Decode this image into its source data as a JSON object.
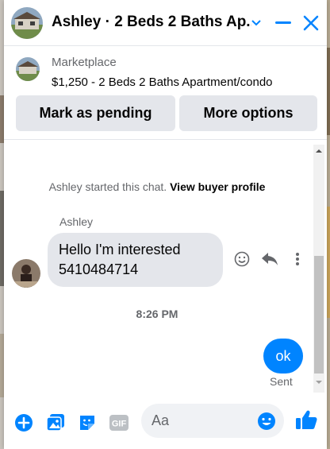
{
  "header": {
    "title": "Ashley · 2 Beds 2 Baths Ap..."
  },
  "listing": {
    "label": "Marketplace",
    "title": "$1,250 - 2 Beds 2 Baths Apartment/condo",
    "mark_pending_label": "Mark as pending",
    "more_options_label": "More options"
  },
  "conversation": {
    "started_text": "Ashley started this chat.",
    "view_profile_link": "View buyer profile",
    "sender_name": "Ashley",
    "incoming_line1": "Hello I'm interested",
    "incoming_line2": "5410484714",
    "timestamp": "8:26 PM",
    "outgoing_text": "ok",
    "status": "Sent"
  },
  "composer": {
    "placeholder": "Aa",
    "gif_label": "GIF"
  },
  "colors": {
    "accent": "#0084ff",
    "bubble_in": "#e4e6eb",
    "secondary_text": "#65676b"
  },
  "icons": [
    "chevron-down-icon",
    "minimize-icon",
    "close-icon",
    "smile-icon",
    "reply-icon",
    "more-icon",
    "plus-icon",
    "image-icon",
    "sticker-icon",
    "gif-icon",
    "emoji-icon",
    "thumbs-up-icon"
  ]
}
